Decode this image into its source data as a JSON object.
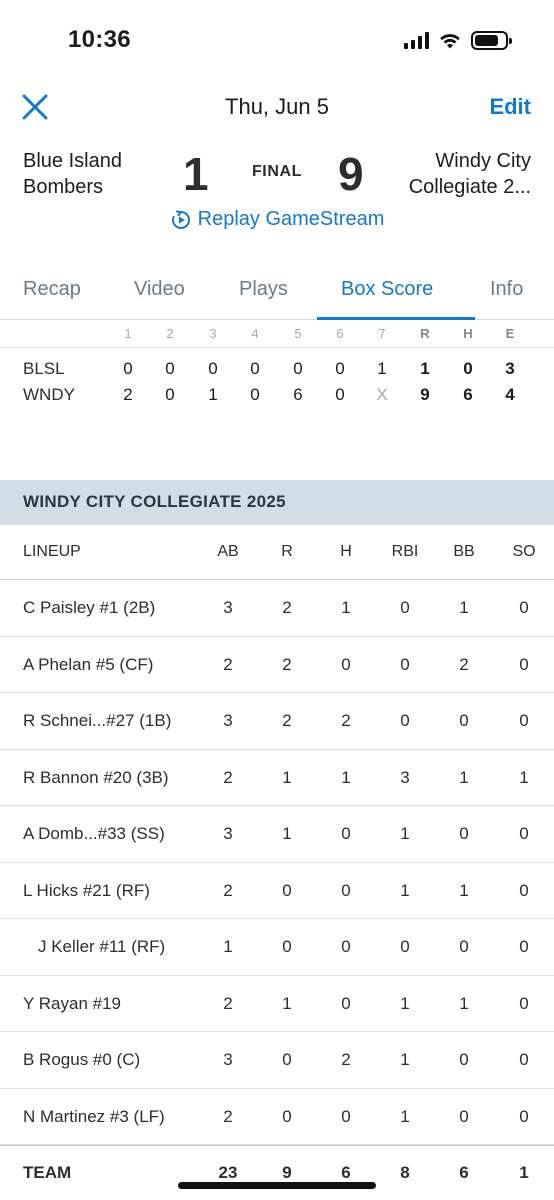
{
  "status_bar": {
    "time": "10:36"
  },
  "nav": {
    "title": "Thu, Jun 5",
    "edit_label": "Edit"
  },
  "game": {
    "away_name": "Blue Island Bombers",
    "away_score": "1",
    "status": "FINAL",
    "home_score": "9",
    "home_name": "Windy City Collegiate 2..."
  },
  "replay_label": "Replay GameStream",
  "tabs": [
    {
      "label": "Recap"
    },
    {
      "label": "Video"
    },
    {
      "label": "Plays"
    },
    {
      "label": "Box Score",
      "active": true
    },
    {
      "label": "Info"
    }
  ],
  "linescore": {
    "headers": [
      "1",
      "2",
      "3",
      "4",
      "5",
      "6",
      "7",
      "R",
      "H",
      "E"
    ],
    "rows": [
      {
        "team": "BLSL",
        "cells": [
          "0",
          "0",
          "0",
          "0",
          "0",
          "0",
          "1",
          "1",
          "0",
          "3"
        ]
      },
      {
        "team": "WNDY",
        "cells": [
          "2",
          "0",
          "1",
          "0",
          "6",
          "0",
          "X",
          "9",
          "6",
          "4"
        ]
      }
    ]
  },
  "team_section": {
    "title": "WINDY CITY COLLEGIATE 2025",
    "headers": {
      "name": "LINEUP",
      "stats": [
        "AB",
        "R",
        "H",
        "RBI",
        "BB",
        "SO"
      ]
    },
    "players": [
      {
        "name": "C Paisley #1 (2B)",
        "stats": [
          "3",
          "2",
          "1",
          "0",
          "1",
          "0"
        ]
      },
      {
        "name": "A Phelan #5 (CF)",
        "stats": [
          "2",
          "2",
          "0",
          "0",
          "2",
          "0"
        ]
      },
      {
        "name": "R Schnei...#27 (1B)",
        "stats": [
          "3",
          "2",
          "2",
          "0",
          "0",
          "0"
        ]
      },
      {
        "name": "R Bannon #20 (3B)",
        "stats": [
          "2",
          "1",
          "1",
          "3",
          "1",
          "1"
        ]
      },
      {
        "name": "A Domb...#33 (SS)",
        "stats": [
          "3",
          "1",
          "0",
          "1",
          "0",
          "0"
        ]
      },
      {
        "name": "L Hicks #21 (RF)",
        "stats": [
          "2",
          "0",
          "0",
          "1",
          "1",
          "0"
        ]
      },
      {
        "name": "J Keller #11 (RF)",
        "stats": [
          "1",
          "0",
          "0",
          "0",
          "0",
          "0"
        ],
        "substitute": true
      },
      {
        "name": "Y Rayan #19",
        "stats": [
          "2",
          "1",
          "0",
          "1",
          "1",
          "0"
        ]
      },
      {
        "name": "B Rogus #0 (C)",
        "stats": [
          "3",
          "0",
          "2",
          "1",
          "0",
          "0"
        ]
      },
      {
        "name": "N Martinez #3 (LF)",
        "stats": [
          "2",
          "0",
          "0",
          "1",
          "0",
          "0"
        ]
      }
    ],
    "totals": {
      "name": "TEAM",
      "stats": [
        "23",
        "9",
        "6",
        "8",
        "6",
        "1"
      ]
    }
  },
  "colors": {
    "accent": "#1479c9",
    "banner": "#d4dde3"
  }
}
